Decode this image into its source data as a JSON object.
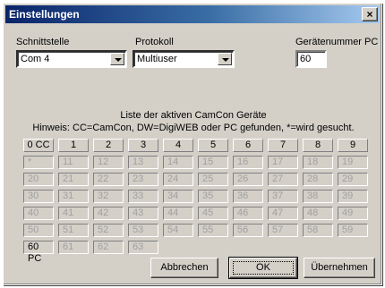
{
  "window": {
    "title": "Einstellungen",
    "close_glyph": "×"
  },
  "labels": {
    "schnittstelle": "Schnittstelle",
    "protokoll": "Protokoll",
    "geraetenummer": "Gerätenummer PC"
  },
  "fields": {
    "schnittstelle_value": "Com 4",
    "protokoll_value": "Multiuser",
    "geraetenummer_value": "60"
  },
  "list_title": "Liste der aktiven CamCon Geräte",
  "hint": "Hinweis: CC=CamCon, DW=DigiWEB oder PC gefunden, *=wird gesucht.",
  "grid": {
    "header": [
      "0 CC",
      "1",
      "2",
      "3",
      "4",
      "5",
      "6",
      "7",
      "8",
      "9"
    ],
    "rows": [
      [
        "*",
        "11",
        "12",
        "13",
        "14",
        "15",
        "16",
        "17",
        "18",
        "19"
      ],
      [
        "20",
        "21",
        "22",
        "23",
        "24",
        "25",
        "26",
        "27",
        "28",
        "29"
      ],
      [
        "30",
        "31",
        "32",
        "33",
        "34",
        "35",
        "36",
        "37",
        "38",
        "39"
      ],
      [
        "40",
        "41",
        "42",
        "43",
        "44",
        "45",
        "46",
        "47",
        "48",
        "49"
      ],
      [
        "50",
        "51",
        "52",
        "53",
        "54",
        "55",
        "56",
        "57",
        "58",
        "59"
      ],
      [
        "60 PC",
        "61",
        "62",
        "63"
      ]
    ],
    "active_cells": [
      "60 PC"
    ]
  },
  "buttons": {
    "cancel": "Abbrechen",
    "ok": "OK",
    "apply": "Übernehmen"
  }
}
